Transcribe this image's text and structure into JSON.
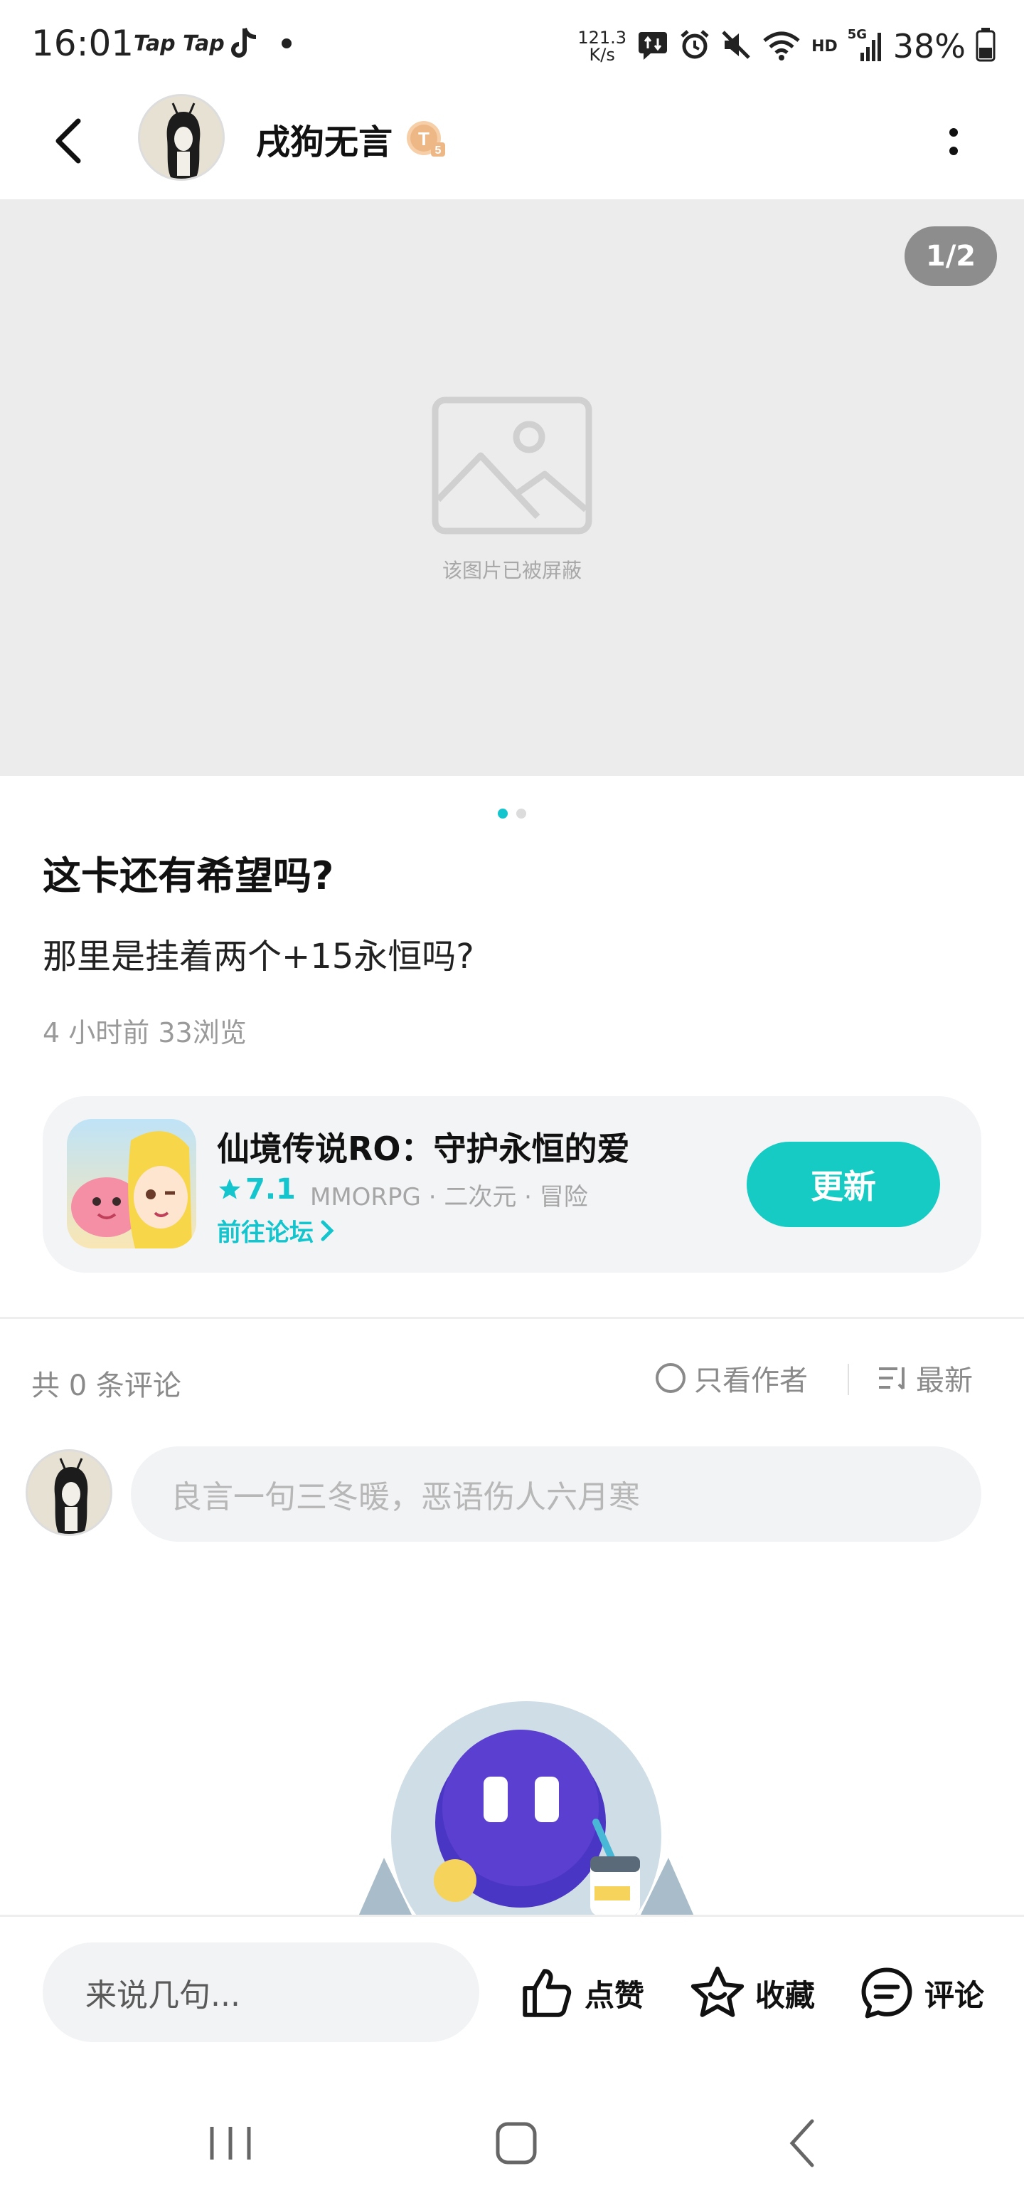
{
  "status_bar": {
    "time": "16:01",
    "apps": [
      "Tap Tap",
      "TikTok"
    ],
    "speed_top": "121.3",
    "speed_bottom": "K/s",
    "network_label": "HD",
    "signal_label": "5G",
    "battery": "38%"
  },
  "header": {
    "author_name": "戌狗无言",
    "level_badge": "T5"
  },
  "image_panel": {
    "page_counter": "1/2",
    "blocked_text": "该图片已被屏蔽"
  },
  "post": {
    "title": "这卡还有希望吗?",
    "body": "那里是挂着两个+15永恒吗?",
    "meta": "4 小时前  33浏览"
  },
  "game_card": {
    "name": "仙境传说RO：守护永恒的爱",
    "rating": "7.1",
    "tags": "MMORPG · 二次元 · 冒险",
    "forum_link": "前往论坛",
    "update_button": "更新"
  },
  "comments": {
    "count_text": "共 0 条评论",
    "author_only": "只看作者",
    "sort": "最新",
    "input_placeholder": "良言一句三冬暖，恶语伤人六月寒"
  },
  "bottom_bar": {
    "say_placeholder": "来说几句...",
    "like_label": "点赞",
    "favorite_label": "收藏",
    "comment_label": "评论"
  },
  "colors": {
    "accent": "#15c5ce",
    "button": "#15cbc3",
    "image_bg": "#ececec"
  }
}
